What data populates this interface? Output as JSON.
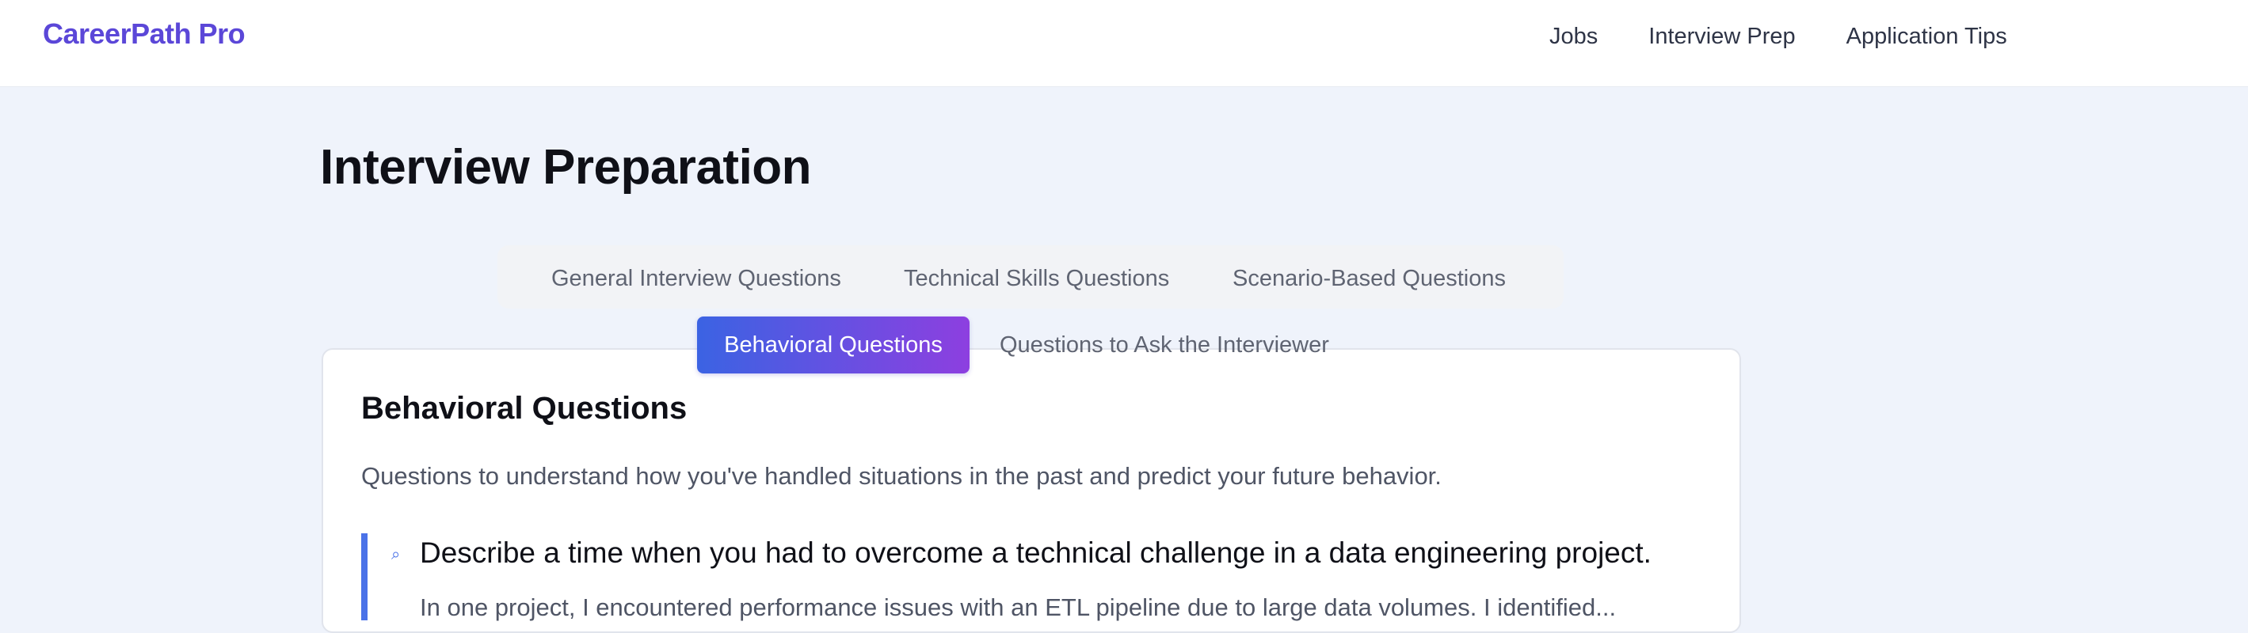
{
  "header": {
    "brand": "CareerPath Pro",
    "nav": [
      "Jobs",
      "Interview Prep",
      "Application Tips"
    ]
  },
  "page": {
    "title": "Interview Preparation"
  },
  "tabs": {
    "general": "General Interview Questions",
    "technical": "Technical Skills Questions",
    "scenario": "Scenario-Based Questions",
    "behavioral": "Behavioral Questions",
    "ask": "Questions to Ask the Interviewer"
  },
  "section": {
    "title": "Behavioral Questions",
    "description": "Questions to understand how you've handled situations in the past and predict your future behavior.",
    "question_icon": "search-icon",
    "question": "Describe a time when you had to overcome a technical challenge in a data engineering project.",
    "answer": "In one project, I encountered performance issues with an ETL pipeline due to large data volumes. I identified..."
  },
  "colors": {
    "brand_gradient_start": "#3b63e3",
    "brand_gradient_end": "#8d3fe0",
    "accent": "#4a72e8",
    "page_bg": "#eff3fb"
  }
}
